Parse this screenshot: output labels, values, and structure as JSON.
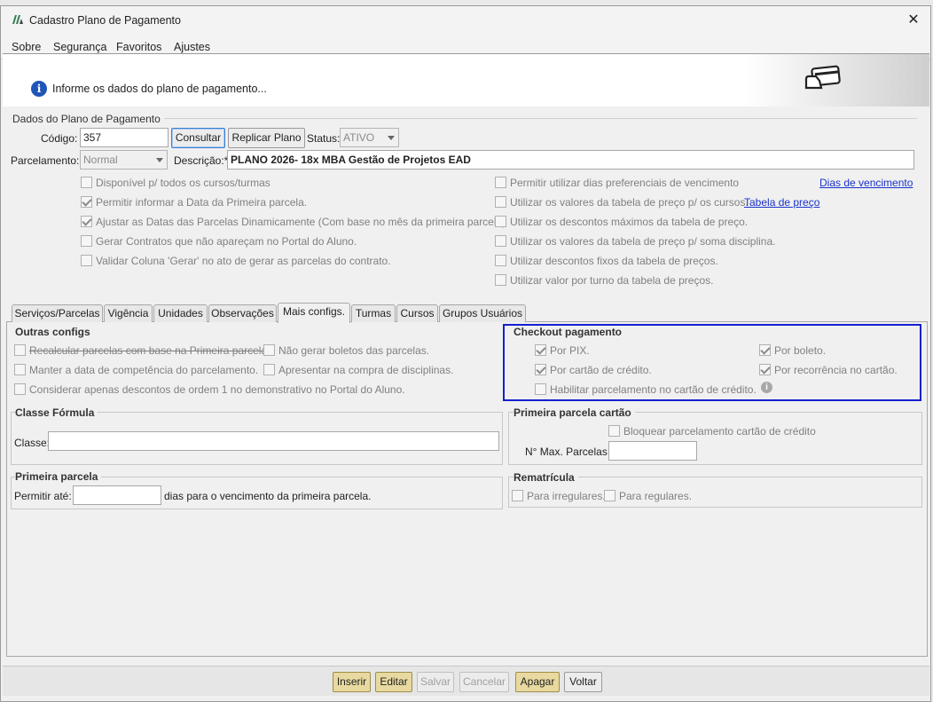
{
  "window": {
    "title": "Cadastro Plano de Pagamento",
    "close": "✕"
  },
  "menu": [
    "Sobre",
    "Segurança",
    "Favoritos",
    "Ajustes"
  ],
  "banner": {
    "info_text": "Informe os dados do plano de pagamento...",
    "info_icon": "i"
  },
  "plan": {
    "section_title": "Dados do Plano de Pagamento",
    "codigo_label": "Código:",
    "codigo_value": "357",
    "consultar": "Consultar",
    "replicar": "Replicar Plano",
    "status_label": "Status:",
    "status_value": "ATIVO",
    "parcelamento_label": "Parcelamento:",
    "parcelamento_value": "Normal",
    "descricao_label": "Descrição:*",
    "descricao_value": "PLANO 2026- 18x MBA Gestão de Projetos EAD",
    "left_options": [
      {
        "label": "Disponível p/ todos os cursos/turmas",
        "checked": false
      },
      {
        "label": "Permitir informar a Data da Primeira parcela.",
        "checked": true
      },
      {
        "label": "Ajustar as Datas das Parcelas Dinamicamente (Com base no mês da primeira parcela)",
        "checked": true
      },
      {
        "label": "Gerar Contratos que não apareçam no Portal do Aluno.",
        "checked": false
      },
      {
        "label": "Validar Coluna 'Gerar' no ato de gerar as parcelas do contrato.",
        "checked": false
      }
    ],
    "right_options": [
      {
        "label": "Permitir utilizar dias preferenciais de vencimento",
        "checked": false
      },
      {
        "label": "Utilizar os valores da tabela de preço p/ os cursos.",
        "checked": false
      },
      {
        "label": "Utilizar os descontos máximos da tabela de preço.",
        "checked": false
      },
      {
        "label": "Utilizar os valores da tabela de preço p/ soma disciplina.",
        "checked": false
      },
      {
        "label": "Utilizar descontos fixos da tabela de preços.",
        "checked": false
      },
      {
        "label": "Utilizar valor por turno da tabela de preços.",
        "checked": false
      }
    ],
    "link_dias": "Dias de vencimento",
    "link_tabela": "Tabela de preço"
  },
  "tabs": [
    "Serviços/Parcelas",
    "Vigência",
    "Unidades",
    "Observações",
    "Mais configs.",
    "Turmas",
    "Cursos",
    "Grupos Usuários"
  ],
  "outras": {
    "title": "Outras configs",
    "items": [
      {
        "label": "Recalcular parcelas com base na Primeira parcela.",
        "checked": false
      },
      {
        "label": "Não gerar boletos das parcelas.",
        "checked": false
      },
      {
        "label": "Manter a data de competência do parcelamento.",
        "checked": false
      },
      {
        "label": "Apresentar na compra de disciplinas.",
        "checked": false
      },
      {
        "label": "Considerar apenas descontos de ordem 1 no demonstrativo no Portal do Aluno.",
        "checked": false
      }
    ]
  },
  "checkout": {
    "title": "Checkout pagamento",
    "items": [
      {
        "label": "Por PIX.",
        "checked": true
      },
      {
        "label": "Por boleto.",
        "checked": true
      },
      {
        "label": "Por cartão de crédito.",
        "checked": true
      },
      {
        "label": "Por recorrência no cartão.",
        "checked": true
      },
      {
        "label": "Habilitar parcelamento no cartão de crédito.",
        "checked": false
      }
    ]
  },
  "classe": {
    "title": "Classe Fórmula",
    "label": "Classe:",
    "value": ""
  },
  "primeira_cartao": {
    "title": "Primeira parcela cartão",
    "bloquear": "Bloquear parcelamento cartão de crédito",
    "max_label": "N° Max. Parcelas:",
    "max_value": ""
  },
  "primeira": {
    "title": "Primeira parcela",
    "label": "Permitir até:",
    "value": "",
    "suffix": "dias para o vencimento da primeira parcela."
  },
  "rematricula": {
    "title": "Rematrícula",
    "irregulares": "Para irregulares.",
    "regulares": "Para regulares."
  },
  "buttons": {
    "inserir": "Inserir",
    "editar": "Editar",
    "salvar": "Salvar",
    "cancelar": "Cancelar",
    "apagar": "Apagar",
    "voltar": "Voltar"
  },
  "colors": {
    "highlight": "#1520d0",
    "link": "#1a33cc",
    "info_icon": "#1f55b8"
  }
}
